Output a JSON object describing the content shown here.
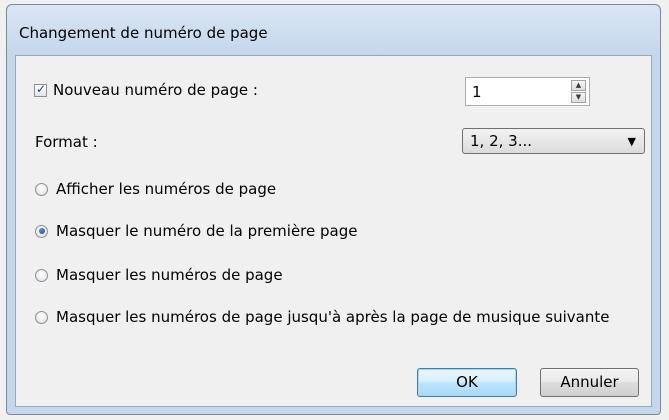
{
  "dialog": {
    "title": "Changement de numéro de page",
    "new_page_number": {
      "checked": true,
      "label": "Nouveau numéro de page :",
      "value": "1"
    },
    "format": {
      "label": "Format :",
      "selected": "1, 2, 3..."
    },
    "options": [
      {
        "label": "Afficher les numéros de page",
        "selected": false
      },
      {
        "label": "Masquer le numéro de la première page",
        "selected": true
      },
      {
        "label": "Masquer les numéros de page",
        "selected": false
      },
      {
        "label": "Masquer les numéros de page jusqu'à après la page de musique suivante",
        "selected": false
      }
    ],
    "buttons": {
      "ok": "OK",
      "cancel": "Annuler"
    }
  }
}
